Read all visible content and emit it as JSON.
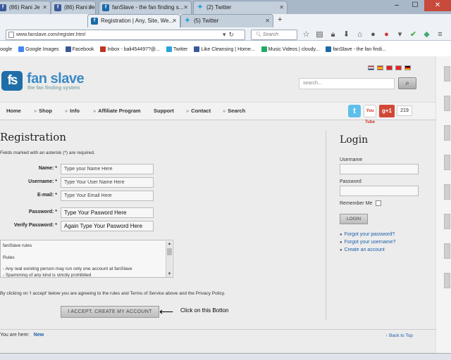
{
  "browser": {
    "tabs": [
      {
        "label": "(86) Rani Je",
        "icon": "facebook-icon",
        "active": false
      },
      {
        "label": "(86) Rani Je",
        "icon": "facebook-icon",
        "active": false
      },
      {
        "label": "fanSlave - the fan finding s...",
        "icon": "fanslave-icon",
        "active": false
      },
      {
        "label": "(2) Twitter",
        "icon": "twitter-icon",
        "active": false
      },
      {
        "label": "Registration | Any, Site, We...",
        "icon": "fanslave-icon",
        "active": true
      },
      {
        "label": "(5) Twitter",
        "icon": "twitter-icon",
        "active": false
      }
    ],
    "url": "www.fanslave.com/register.html",
    "search_placeholder": "Search",
    "bookmarks": [
      {
        "label": "oogle",
        "color": "#4285f4"
      },
      {
        "label": "Google Images",
        "color": "#4285f4"
      },
      {
        "label": "Facebook",
        "color": "#3b5998"
      },
      {
        "label": "Inbox - bali454497?@...",
        "color": "#c23321"
      },
      {
        "label": "Twitter",
        "color": "#2ba2e0"
      },
      {
        "label": "Like Cleansing | Home...",
        "color": "#3b5998"
      },
      {
        "label": "Music Videos | cloudy...",
        "color": "#2a6"
      },
      {
        "label": "fanSlave - the fan findi...",
        "color": "#1a6aa8"
      }
    ]
  },
  "site": {
    "logo": {
      "mark": "fs",
      "name": "fan slave",
      "tagline": "the fan finding system"
    },
    "search_placeholder": "search...",
    "nav": [
      "Home",
      "Shop",
      "Info",
      "Affiliate Program",
      "Support",
      "Contact",
      "Search"
    ],
    "social_gplus": "g+1",
    "social_count": "219",
    "social_youtube": "You Tube",
    "social_twitter": "t"
  },
  "registration": {
    "title": "Registration",
    "note": "Fields marked with an asterisk (*) are required.",
    "fields": [
      {
        "label": "Name: *",
        "value": "Type your Name Here"
      },
      {
        "label": "Username: *",
        "value": "Type Your User Name Here"
      },
      {
        "label": "E-mail: *",
        "value": "Type Your Email Here"
      },
      {
        "label": "Password: *",
        "value": "Type Your Pasword Here"
      },
      {
        "label": "Verify Password: *",
        "value": "Again Type Your Pasword Here"
      }
    ],
    "rules_lines": [
      "fanSlave rules",
      "Rules",
      "- Any real existing person may run only one account at fanSlave",
      "- Spamming of any kind is strictly prohibited"
    ],
    "agree_text": "By clicking on 'I accept' below you are agreeing to the rules and Terms of Service above and the Privacy Policy.",
    "accept_button": "I ACCEPT. CREATE MY ACCOUNT",
    "annotation": "Click on this Botton"
  },
  "login": {
    "title": "Login",
    "username_label": "Username",
    "password_label": "Password",
    "remember_label": "Remember Me",
    "button": "LOGIN",
    "links": [
      "Forgot your password?",
      "Forgot your username?",
      "Create an account"
    ]
  },
  "footer": {
    "you_are_here": "You are here:",
    "crumb": "New",
    "back_to_top": "Back to Top"
  }
}
